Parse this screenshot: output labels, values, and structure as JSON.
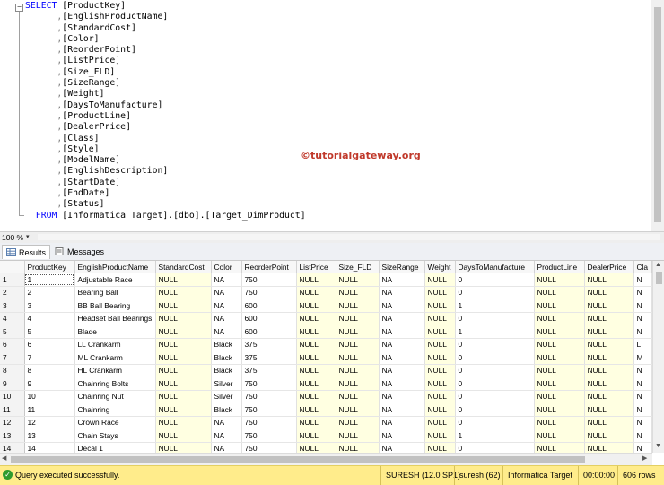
{
  "editor": {
    "lines": [
      {
        "kw": "SELECT",
        "text": " [ProductKey]"
      },
      {
        "comma": ",",
        "text": "[EnglishProductName]"
      },
      {
        "comma": ",",
        "text": "[StandardCost]"
      },
      {
        "comma": ",",
        "text": "[Color]"
      },
      {
        "comma": ",",
        "text": "[ReorderPoint]"
      },
      {
        "comma": ",",
        "text": "[ListPrice]"
      },
      {
        "comma": ",",
        "text": "[Size_FLD]"
      },
      {
        "comma": ",",
        "text": "[SizeRange]"
      },
      {
        "comma": ",",
        "text": "[Weight]"
      },
      {
        "comma": ",",
        "text": "[DaysToManufacture]"
      },
      {
        "comma": ",",
        "text": "[ProductLine]"
      },
      {
        "comma": ",",
        "text": "[DealerPrice]"
      },
      {
        "comma": ",",
        "text": "[Class]"
      },
      {
        "comma": ",",
        "text": "[Style]"
      },
      {
        "comma": ",",
        "text": "[ModelName]"
      },
      {
        "comma": ",",
        "text": "[EnglishDescription]"
      },
      {
        "comma": ",",
        "text": "[StartDate]"
      },
      {
        "comma": ",",
        "text": "[EndDate]"
      },
      {
        "comma": ",",
        "text": "[Status]"
      },
      {
        "kw": "FROM",
        "text": " [Informatica Target].[dbo].[Target_DimProduct]"
      }
    ],
    "watermark": "©tutorialgateway.org",
    "collapse_glyph": "−"
  },
  "zoom": {
    "value": "100 %",
    "arrow": "▾"
  },
  "tabs": [
    {
      "label": "Results",
      "active": true
    },
    {
      "label": "Messages",
      "active": false
    }
  ],
  "grid": {
    "columns": [
      "",
      "ProductKey",
      "EnglishProductName",
      "StandardCost",
      "Color",
      "ReorderPoint",
      "ListPrice",
      "Size_FLD",
      "SizeRange",
      "Weight",
      "DaysToManufacture",
      "ProductLine",
      "DealerPrice",
      "Cla"
    ],
    "rows": [
      [
        "1",
        "1",
        "Adjustable Race",
        "NULL",
        "NA",
        "750",
        "NULL",
        "NULL",
        "NA",
        "NULL",
        "0",
        "NULL",
        "NULL",
        "N"
      ],
      [
        "2",
        "2",
        "Bearing Ball",
        "NULL",
        "NA",
        "750",
        "NULL",
        "NULL",
        "NA",
        "NULL",
        "0",
        "NULL",
        "NULL",
        "N"
      ],
      [
        "3",
        "3",
        "BB Ball Bearing",
        "NULL",
        "NA",
        "600",
        "NULL",
        "NULL",
        "NA",
        "NULL",
        "1",
        "NULL",
        "NULL",
        "N"
      ],
      [
        "4",
        "4",
        "Headset Ball Bearings",
        "NULL",
        "NA",
        "600",
        "NULL",
        "NULL",
        "NA",
        "NULL",
        "0",
        "NULL",
        "NULL",
        "N"
      ],
      [
        "5",
        "5",
        "Blade",
        "NULL",
        "NA",
        "600",
        "NULL",
        "NULL",
        "NA",
        "NULL",
        "1",
        "NULL",
        "NULL",
        "N"
      ],
      [
        "6",
        "6",
        "LL Crankarm",
        "NULL",
        "Black",
        "375",
        "NULL",
        "NULL",
        "NA",
        "NULL",
        "0",
        "NULL",
        "NULL",
        "L"
      ],
      [
        "7",
        "7",
        "ML Crankarm",
        "NULL",
        "Black",
        "375",
        "NULL",
        "NULL",
        "NA",
        "NULL",
        "0",
        "NULL",
        "NULL",
        "M"
      ],
      [
        "8",
        "8",
        "HL Crankarm",
        "NULL",
        "Black",
        "375",
        "NULL",
        "NULL",
        "NA",
        "NULL",
        "0",
        "NULL",
        "NULL",
        "N"
      ],
      [
        "9",
        "9",
        "Chainring Bolts",
        "NULL",
        "Silver",
        "750",
        "NULL",
        "NULL",
        "NA",
        "NULL",
        "0",
        "NULL",
        "NULL",
        "N"
      ],
      [
        "10",
        "10",
        "Chainring Nut",
        "NULL",
        "Silver",
        "750",
        "NULL",
        "NULL",
        "NA",
        "NULL",
        "0",
        "NULL",
        "NULL",
        "N"
      ],
      [
        "11",
        "11",
        "Chainring",
        "NULL",
        "Black",
        "750",
        "NULL",
        "NULL",
        "NA",
        "NULL",
        "0",
        "NULL",
        "NULL",
        "N"
      ],
      [
        "12",
        "12",
        "Crown Race",
        "NULL",
        "NA",
        "750",
        "NULL",
        "NULL",
        "NA",
        "NULL",
        "0",
        "NULL",
        "NULL",
        "N"
      ],
      [
        "13",
        "13",
        "Chain Stays",
        "NULL",
        "NA",
        "750",
        "NULL",
        "NULL",
        "NA",
        "NULL",
        "1",
        "NULL",
        "NULL",
        "N"
      ],
      [
        "14",
        "14",
        "Decal 1",
        "NULL",
        "NA",
        "750",
        "NULL",
        "NULL",
        "NA",
        "NULL",
        "0",
        "NULL",
        "NULL",
        "N"
      ]
    ]
  },
  "status": {
    "message": "Query executed successfully.",
    "server": "SURESH (12.0 SP1)",
    "user": "suresh (62)",
    "database": "Informatica Target",
    "elapsed": "00:00:00",
    "rows": "606 rows"
  },
  "colors": {
    "keyword": "#0000ff",
    "punctuation": "#808080",
    "watermark": "#c0392b",
    "null_cell": "#ffffe1",
    "statusbar": "#ffec8b"
  }
}
